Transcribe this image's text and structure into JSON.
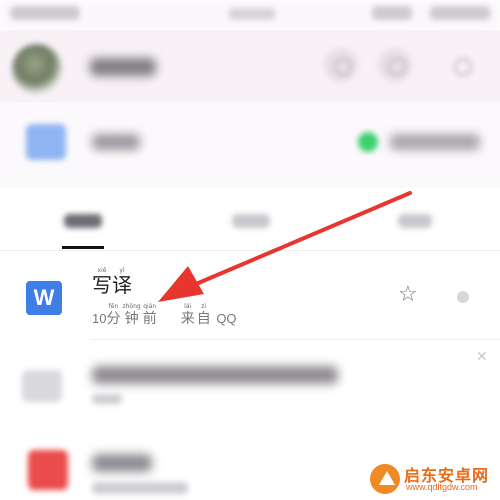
{
  "file": {
    "icon_letter": "W",
    "title_chars": [
      {
        "char": "写",
        "pinyin": "xiě"
      },
      {
        "char": "译",
        "pinyin": "yì"
      }
    ],
    "meta_time": [
      {
        "char": "10",
        "pinyin": ""
      },
      {
        "char": "分",
        "pinyin": "fēn"
      },
      {
        "char": "钟",
        "pinyin": "zhōng"
      },
      {
        "char": "前",
        "pinyin": "qián"
      }
    ],
    "meta_source": [
      {
        "char": "来",
        "pinyin": "lái"
      },
      {
        "char": "自",
        "pinyin": "zì"
      }
    ],
    "meta_source_app": "QQ"
  },
  "annotation": {
    "arrow_color": "#e8362f"
  },
  "watermark": {
    "name": "启东安卓网",
    "url": "www.qdltgdw.com"
  },
  "colors": {
    "file_icon": "#3e7ee6",
    "status_green": "#3ccf6e",
    "red_app": "#ea4b4b"
  }
}
